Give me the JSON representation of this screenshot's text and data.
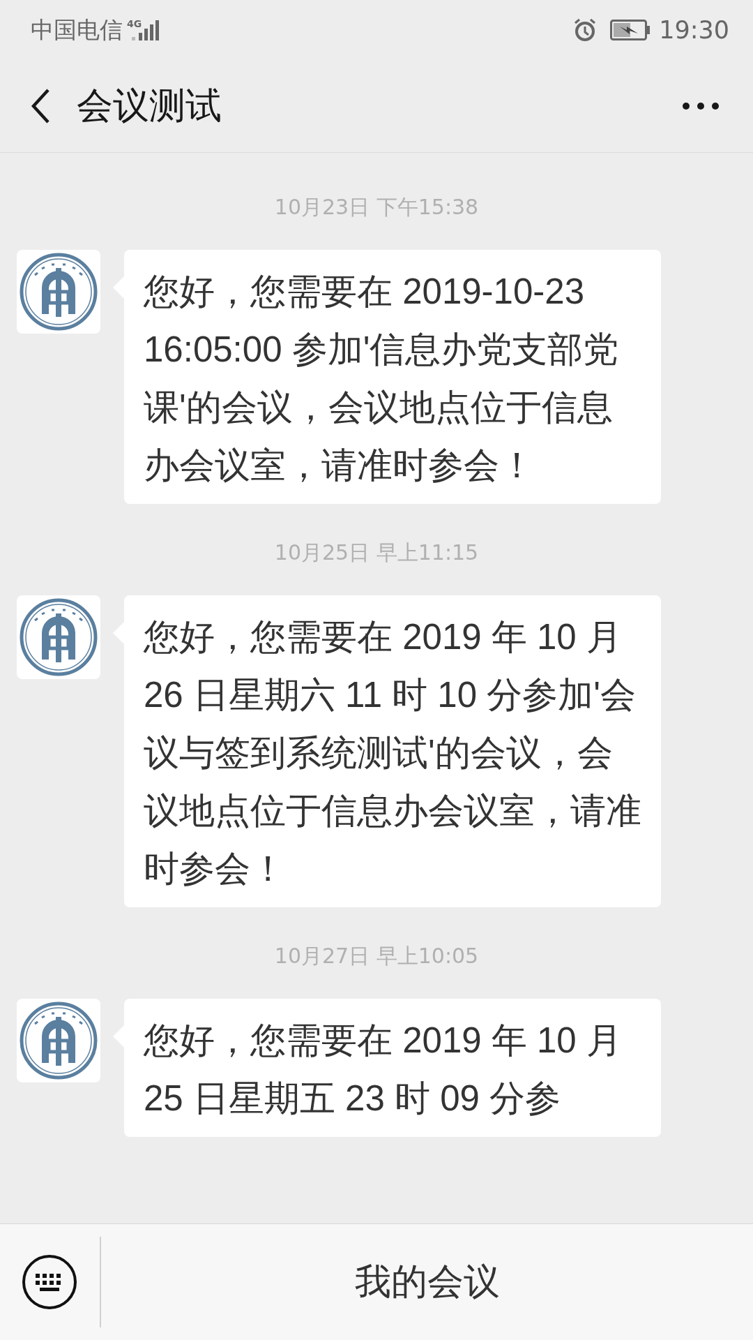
{
  "status_bar": {
    "carrier": "中国电信",
    "network": "4G",
    "time": "19:30"
  },
  "header": {
    "title": "会议测试"
  },
  "messages": [
    {
      "timestamp": "10月23日 下午15:38",
      "text": "您好，您需要在 2019-10-23 16:05:00 参加'信息办党支部党课'的会议，会议地点位于信息办会议室，请准时参会！"
    },
    {
      "timestamp": "10月25日 早上11:15",
      "text": "您好，您需要在 2019 年 10 月 26 日星期六 11 时 10 分参加'会议与签到系统测试'的会议，会议地点位于信息办会议室，请准时参会！"
    },
    {
      "timestamp": "10月27日 早上10:05",
      "text": "您好，您需要在 2019 年 10 月 25 日星期五 23 时 09 分参"
    }
  ],
  "bottom_bar": {
    "menu_label": "我的会议"
  }
}
